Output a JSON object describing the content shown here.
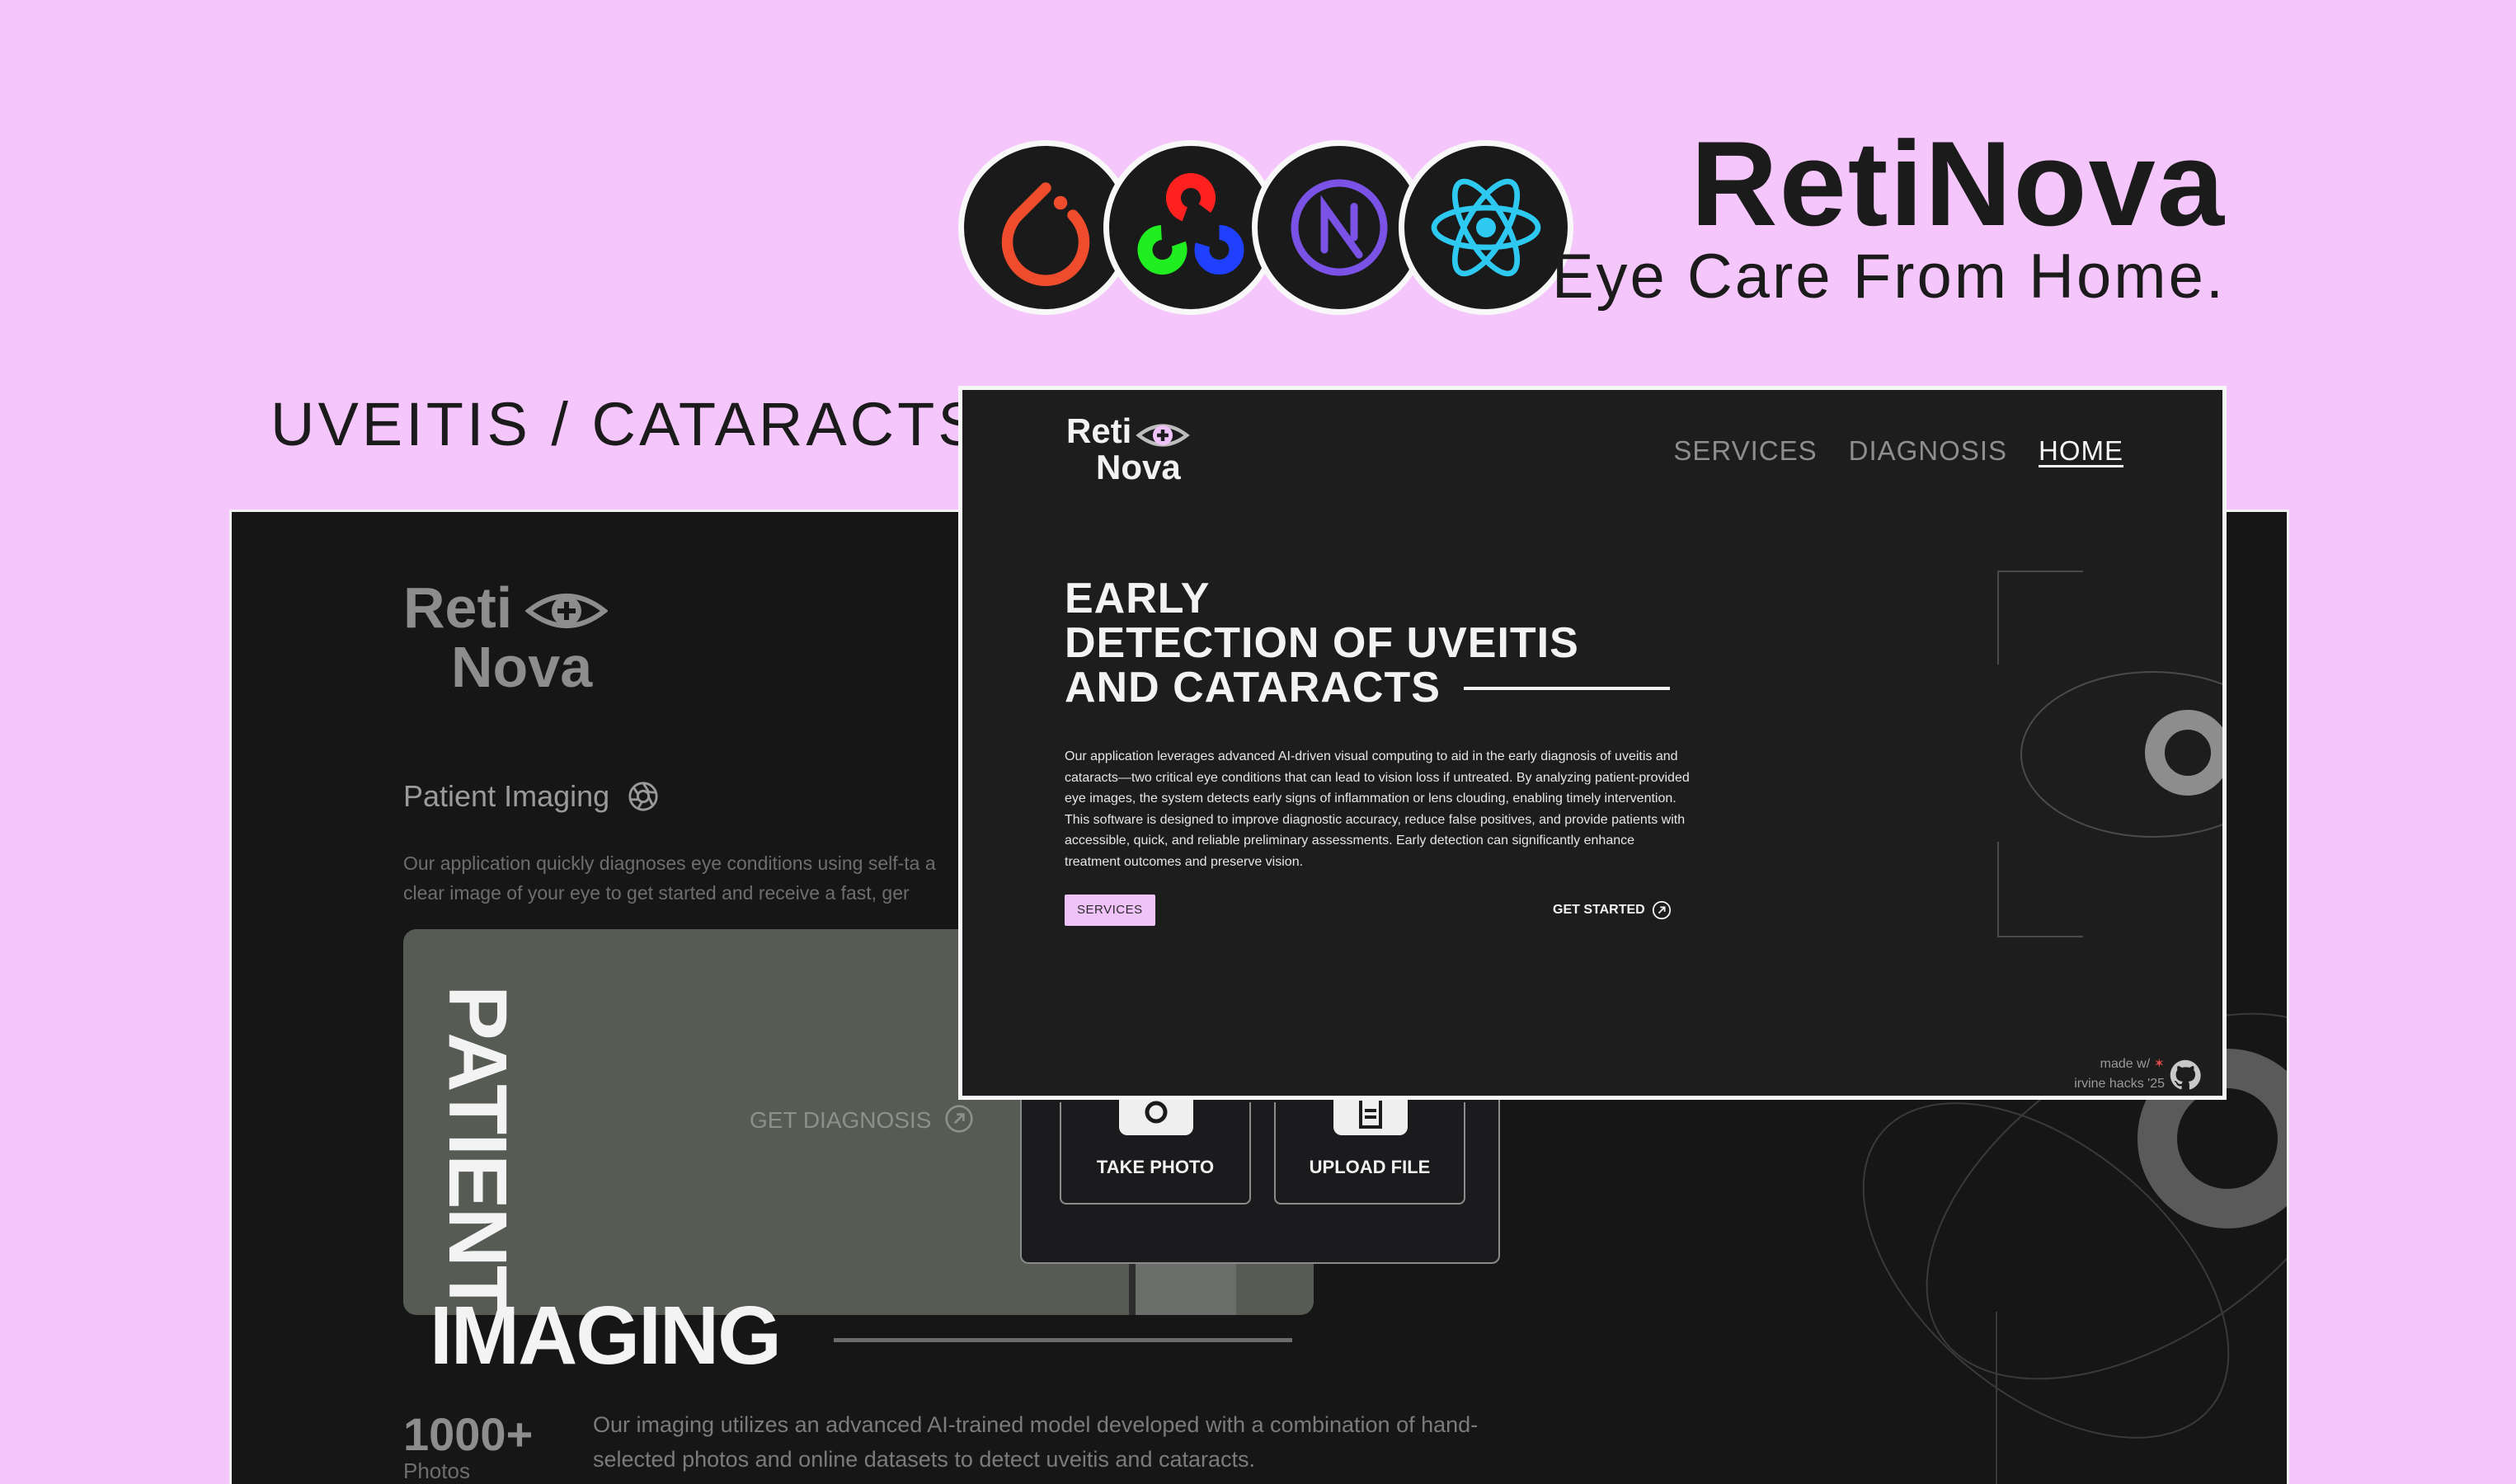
{
  "hero": {
    "brand_title": "RetiNova",
    "tagline": "Eye Care From Home.",
    "section_title": "UVEITIS / CATARACTS",
    "tech_logos": [
      {
        "name": "pytorch-logo-icon",
        "color": "#ee4c2c"
      },
      {
        "name": "opencv-logo-icon",
        "colors": [
          "#ff0000",
          "#00ff00",
          "#0000ff"
        ]
      },
      {
        "name": "nextjs-logo-icon",
        "color": "#6f4ce0"
      },
      {
        "name": "react-logo-icon",
        "color": "#2ec9f0"
      }
    ]
  },
  "imaging_page": {
    "logo_line1": "Reti",
    "logo_line2": "Nova",
    "heading": "Patient Imaging",
    "description": "Our application quickly diagnoses eye conditions using self-ta a clear image of your eye to get started and receive a fast, ger",
    "card_button": "GET DIAGNOSIS",
    "vertical_title": "PATIENT",
    "title": "IMAGING",
    "upload_options": {
      "take_photo": "TAKE PHOTO",
      "upload_file": "UPLOAD FILE"
    },
    "stat_value": "1000+",
    "stat_label": "Photos",
    "stat_description": "Our imaging utilizes an advanced AI-trained model developed with a combination of hand-selected photos and online datasets to detect uveitis and cataracts."
  },
  "home_page": {
    "logo_line1": "Reti",
    "logo_line2": "Nova",
    "nav": {
      "services": "SERVICES",
      "diagnosis": "DIAGNOSIS",
      "home": "HOME"
    },
    "headline_line1": "EARLY",
    "headline_line2": "DETECTION OF UVEITIS",
    "headline_line3": "AND CATARACTS",
    "description": "Our application leverages advanced AI-driven visual computing to aid in the early diagnosis of uveitis and cataracts—two critical eye conditions that can lead to vision loss if untreated. By analyzing patient-provided eye images, the system detects early signs of inflammation or lens clouding, enabling timely intervention. This software is designed to improve diagnostic accuracy, reduce false positives, and provide patients with accessible, quick, and reliable preliminary assessments. Early detection can significantly enhance treatment outcomes and preserve vision.",
    "services_button": "SERVICES",
    "get_started": "GET STARTED",
    "footer_line1": "made w/",
    "footer_line2": "irvine hacks '25",
    "accent_color": "#f0c2fa"
  }
}
